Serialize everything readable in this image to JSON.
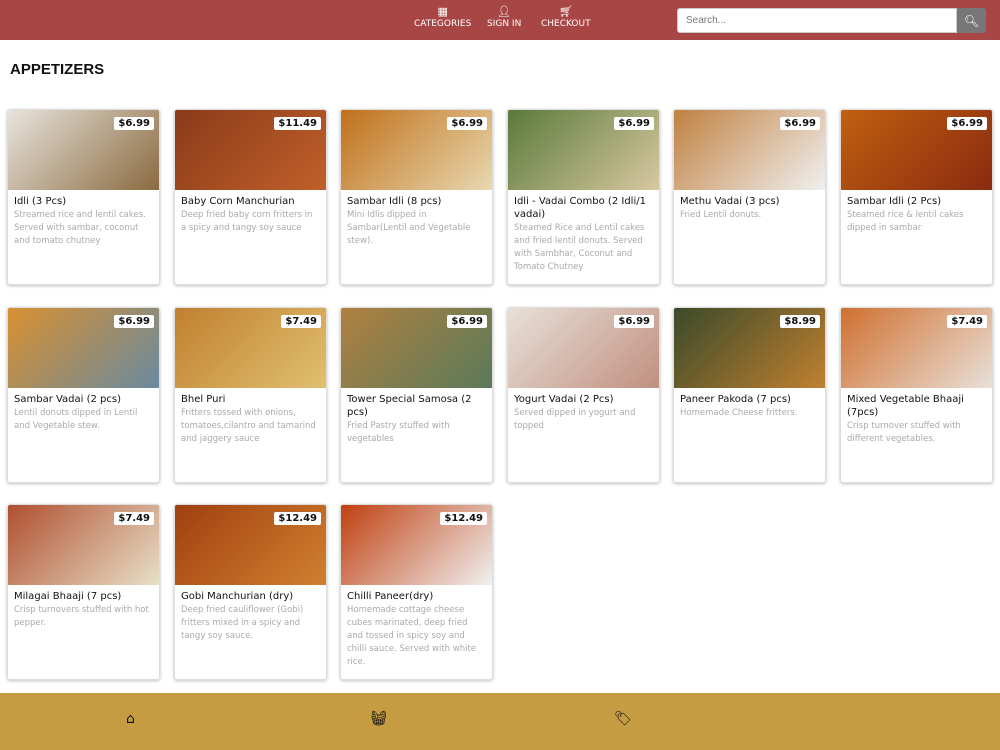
{
  "header": {
    "nav": [
      {
        "icon": "grid-icon",
        "label": "CATEGORIES"
      },
      {
        "icon": "user-icon",
        "label": "SIGN IN"
      },
      {
        "icon": "cart-icon",
        "label": "CHECKOUT"
      }
    ],
    "search_placeholder": "Search...",
    "colors": {
      "header": "#a84645",
      "footer": "#c59c41"
    }
  },
  "section_title": "APPETIZERS",
  "items": [
    {
      "name": "Idli (3 Pcs)",
      "price": "$6.99",
      "desc": "Streamed rice and lentil cakes. Served with sambar, coconut and tomato chutney"
    },
    {
      "name": "Baby Corn Manchurian",
      "price": "$11.49",
      "desc": "Deep fried baby corn fritters in a spicy and tangy soy sauce"
    },
    {
      "name": "Sambar Idli (8 pcs)",
      "price": "$6.99",
      "desc": "Mini Idlis dipped in Sambar(Lentil and Vegetable stew)."
    },
    {
      "name": "Idli - Vadai Combo (2 Idli/1 vadai)",
      "price": "$6.99",
      "desc": "Steamed Rice and Lentil cakes and fried lentil donuts. Served with Sambhar, Coconut and Tomato Chutney"
    },
    {
      "name": "Methu Vadai (3 pcs)",
      "price": "$6.99",
      "desc": "Fried Lentil donuts."
    },
    {
      "name": "Sambar Idli (2 Pcs)",
      "price": "$6.99",
      "desc": "Steamed rice & lentil cakes dipped in sambar"
    },
    {
      "name": "Sambar Vadai (2 pcs)",
      "price": "$6.99",
      "desc": "Lentil donuts dipped in Lentil and Vegetable stew."
    },
    {
      "name": "Bhel Puri",
      "price": "$7.49",
      "desc": "Fritters tossed with onions, tomatoes,cilantro and tamarind and jaggery sauce"
    },
    {
      "name": "Tower Special Samosa (2 pcs)",
      "price": "$6.99",
      "desc": "Fried Pastry stuffed with vegetables"
    },
    {
      "name": "Yogurt Vadai (2 Pcs)",
      "price": "$6.99",
      "desc": "Served dipped in yogurt and topped"
    },
    {
      "name": "Paneer Pakoda (7 pcs)",
      "price": "$8.99",
      "desc": "Homemade Cheese fritters."
    },
    {
      "name": "Mixed Vegetable Bhaaji (7pcs)",
      "price": "$7.49",
      "desc": "Crisp turnover stuffed with different vegetables."
    },
    {
      "name": "Milagai Bhaaji (7 pcs)",
      "price": "$7.49",
      "desc": "Crisp turnovers stuffed with hot pepper."
    },
    {
      "name": "Gobi Manchurian (dry)",
      "price": "$12.49",
      "desc": "Deep fried cauliflower (Gobi) fritters mixed in a spicy and tangy soy sauce."
    },
    {
      "name": "Chilli Paneer(dry)",
      "price": "$12.49",
      "desc": "Homemade cottage cheese cubes marinated, deep fried and tossed in spicy soy and chilli sauce. Served with white rice."
    }
  ],
  "footer": {
    "icons": [
      "home-icon",
      "basket-icon",
      "tag-icon"
    ]
  }
}
